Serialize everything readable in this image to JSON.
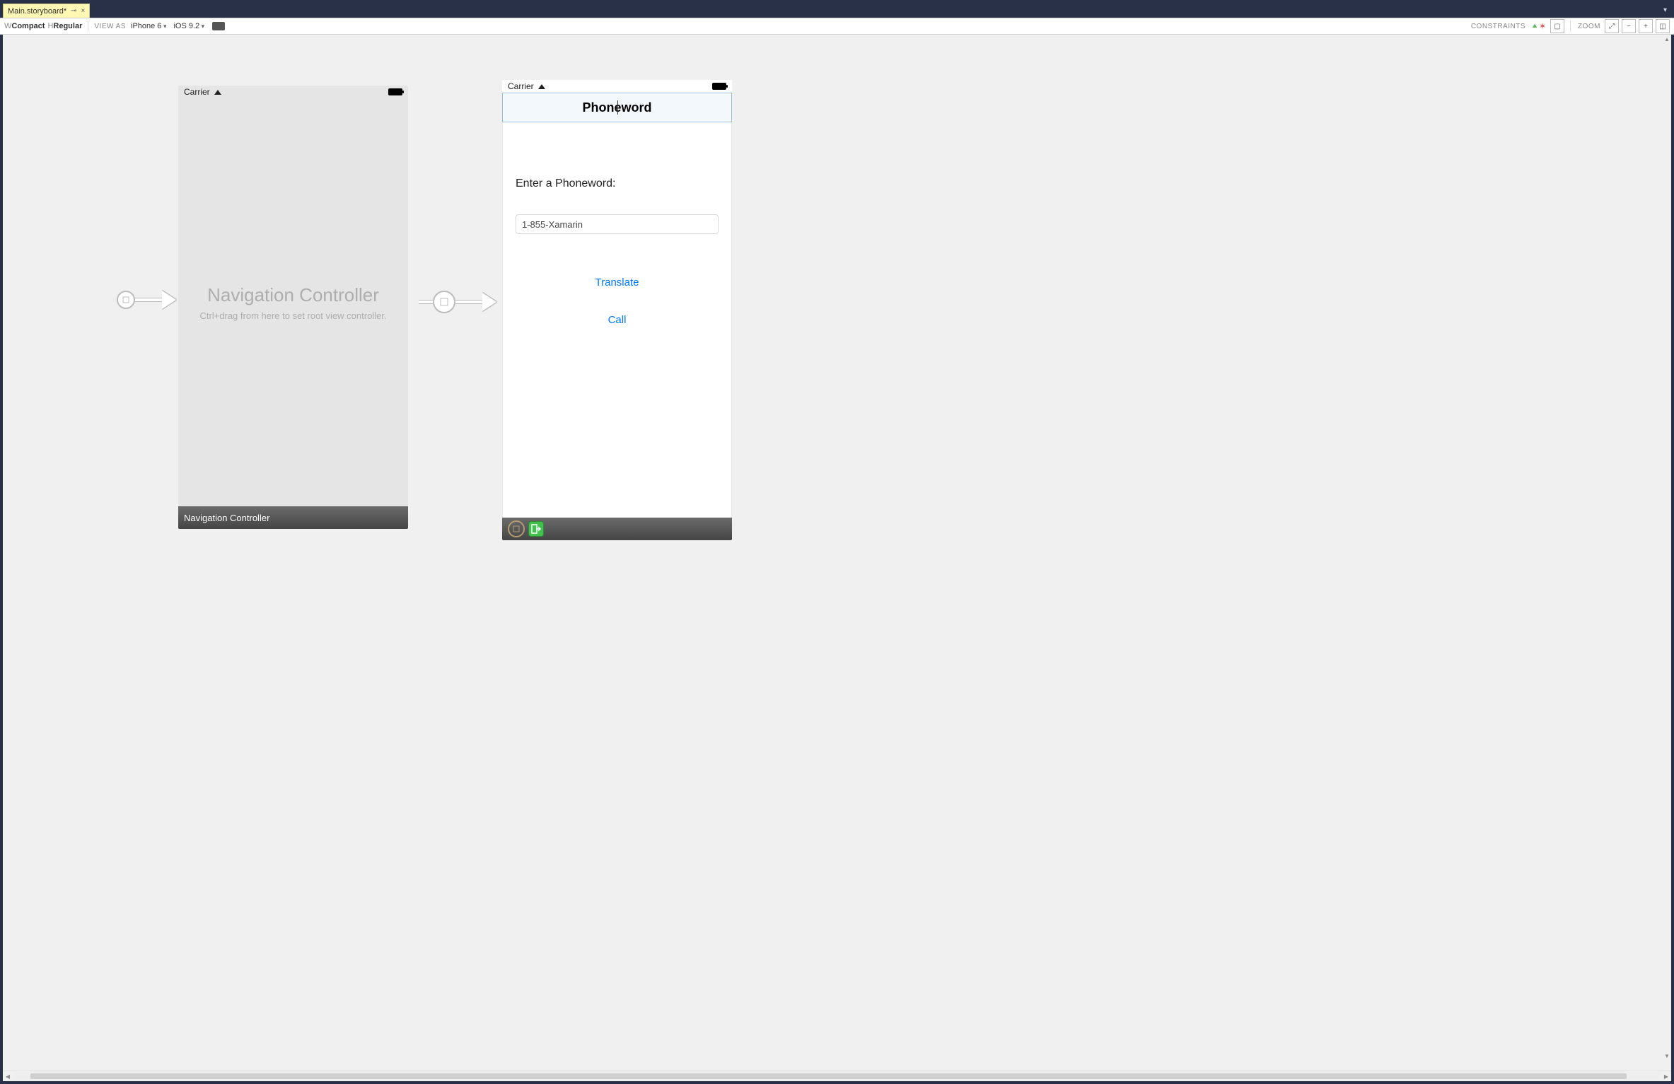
{
  "tab": {
    "title": "Main.storyboard*",
    "pin_glyph": "⊸",
    "close_glyph": "×"
  },
  "options": {
    "w_label": "W",
    "w_value": "Compact",
    "h_label": "H",
    "h_value": "Regular",
    "viewas_label": "VIEW AS",
    "device": "iPhone 6",
    "ios": "iOS 9.2",
    "constraints_label": "CONSTRAINTS",
    "zoom_label": "ZOOM"
  },
  "nav_scene": {
    "carrier": "Carrier",
    "title": "Navigation Controller",
    "hint": "Ctrl+drag from here to set root view controller.",
    "dock_label": "Navigation Controller"
  },
  "detail_scene": {
    "carrier": "Carrier",
    "nav_title": "Phoneword",
    "prompt": "Enter a Phoneword:",
    "textfield_value": "1-855-Xamarin",
    "translate_label": "Translate",
    "call_label": "Call"
  }
}
